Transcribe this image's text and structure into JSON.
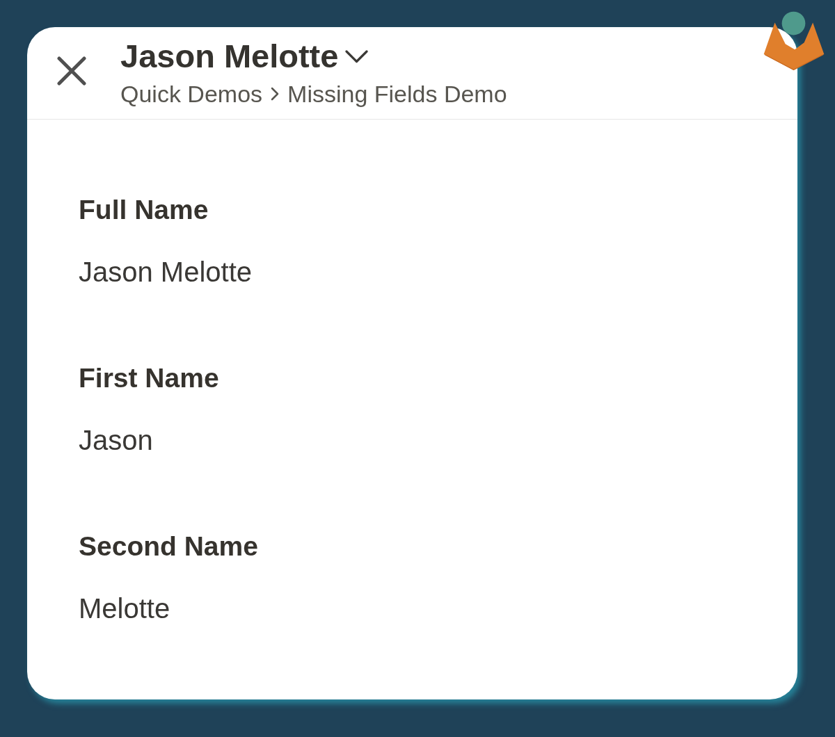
{
  "header": {
    "title": "Jason Melotte",
    "breadcrumb": [
      "Quick Demos",
      "Missing Fields Demo"
    ]
  },
  "fields": [
    {
      "label": "Full Name",
      "value": "Jason Melotte"
    },
    {
      "label": "First Name",
      "value": "Jason"
    },
    {
      "label": "Second Name",
      "value": "Melotte"
    }
  ]
}
